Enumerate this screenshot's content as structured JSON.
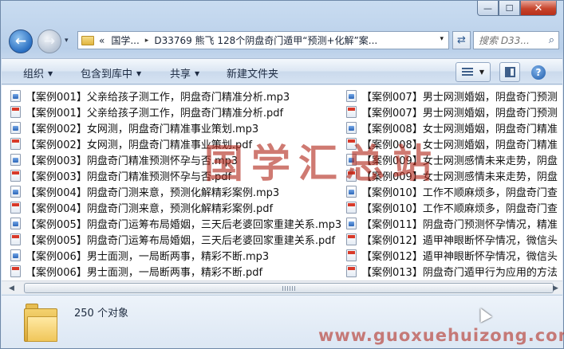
{
  "window": {
    "minimize_glyph": "—",
    "maximize_glyph": "☐",
    "close_glyph": "✕"
  },
  "nav": {
    "back_glyph": "←",
    "forward_glyph": "→",
    "history_glyph": "▾"
  },
  "address": {
    "overflow": "«",
    "segments": [
      "国学...",
      "D33769 熊飞 128个阴盘奇门遁甲“预测+化解”案..."
    ],
    "dropdown_glyph": "▾",
    "refresh_glyph": "⇄"
  },
  "search": {
    "placeholder": "搜索 D33...",
    "icon_glyph": "⌕"
  },
  "toolbar": {
    "organize": "组织",
    "include_in_library": "包含到库中",
    "share": "共享",
    "new_folder": "新建文件夹",
    "dropdown_glyph": "▼",
    "help_glyph": "?"
  },
  "files_left": [
    {
      "name": "【案例001】父亲给孩子测工作，阴盘奇门精准分析.mp3",
      "type": "mp3"
    },
    {
      "name": "【案例001】父亲给孩子测工作，阴盘奇门精准分析.pdf",
      "type": "pdf"
    },
    {
      "name": "【案例002】女网测，阴盘奇门精准事业策划.mp3",
      "type": "mp3"
    },
    {
      "name": "【案例002】女网测，阴盘奇门精准事业策划.pdf",
      "type": "pdf"
    },
    {
      "name": "【案例003】阴盘奇门精准预测怀孕与否.mp3",
      "type": "mp3"
    },
    {
      "name": "【案例003】阴盘奇门精准预测怀孕与否.pdf",
      "type": "pdf"
    },
    {
      "name": "【案例004】阴盘奇门测来意，预测化解精彩案例.mp3",
      "type": "mp3"
    },
    {
      "name": "【案例004】阴盘奇门测来意，预测化解精彩案例.pdf",
      "type": "pdf"
    },
    {
      "name": "【案例005】阴盘奇门运筹布局婚姻，三天后老婆回家重建关系.mp3",
      "type": "mp3"
    },
    {
      "name": "【案例005】阴盘奇门运筹布局婚姻，三天后老婆回家重建关系.pdf",
      "type": "pdf"
    },
    {
      "name": "【案例006】男士面测，一局断两事，精彩不断.mp3",
      "type": "mp3"
    },
    {
      "name": "【案例006】男士面测，一局断两事，精彩不断.pdf",
      "type": "pdf"
    }
  ],
  "files_right": [
    {
      "name": "【案例007】男士网测婚姻，阴盘奇门预测",
      "type": "mp3"
    },
    {
      "name": "【案例007】男士网测婚姻，阴盘奇门预测",
      "type": "pdf"
    },
    {
      "name": "【案例008】女士网测婚姻，阴盘奇门精准",
      "type": "mp3"
    },
    {
      "name": "【案例008】女士网测婚姻，阴盘奇门精准",
      "type": "pdf"
    },
    {
      "name": "【案例009】女士网测感情未来走势，阴盘",
      "type": "mp3"
    },
    {
      "name": "【案例009】女士网测感情未来走势，阴盘",
      "type": "pdf"
    },
    {
      "name": "【案例010】工作不顺麻烦多，阴盘奇门查",
      "type": "mp3"
    },
    {
      "name": "【案例010】工作不顺麻烦多，阴盘奇门查",
      "type": "pdf"
    },
    {
      "name": "【案例011】阴盘奇门预测怀孕情况，精准",
      "type": "mp3"
    },
    {
      "name": "【案例012】遁甲神眼断怀孕情况，微信头",
      "type": "pdf"
    },
    {
      "name": "【案例012】遁甲神眼断怀孕情况，微信头",
      "type": "pdf"
    },
    {
      "name": "【案例013】阴盘奇门遁甲行为应用的方法",
      "type": "pdf"
    }
  ],
  "scrollbar": {
    "left_glyph": "◀",
    "right_glyph": "▶"
  },
  "status": {
    "count": "250 个对象"
  },
  "watermark": {
    "text": "国学汇总站",
    "url": "www.guoxuehuizong.com"
  }
}
